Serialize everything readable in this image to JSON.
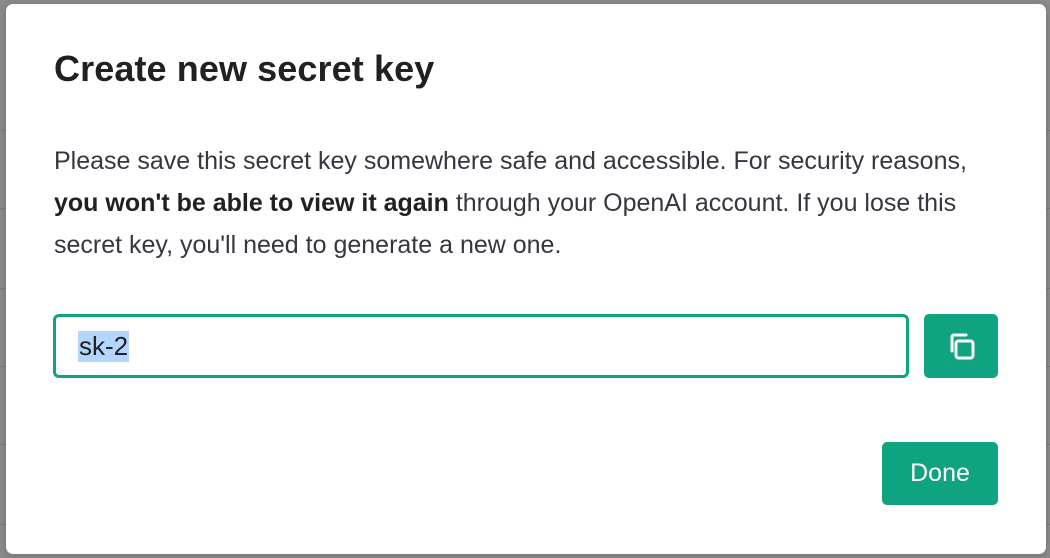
{
  "dialog": {
    "title": "Create new secret key",
    "description_part1": "Please save this secret key somewhere safe and accessible. For security reasons, ",
    "description_bold": "you won't be able to view it again",
    "description_part2": " through your OpenAI account. If you lose this secret key, you'll need to generate a new one.",
    "key_value": "sk-2",
    "copy_icon": "copy-icon",
    "done_label": "Done"
  },
  "colors": {
    "accent": "#10a37f",
    "selection": "#b4d5fe",
    "title_text": "#202123",
    "body_text": "#353740"
  }
}
